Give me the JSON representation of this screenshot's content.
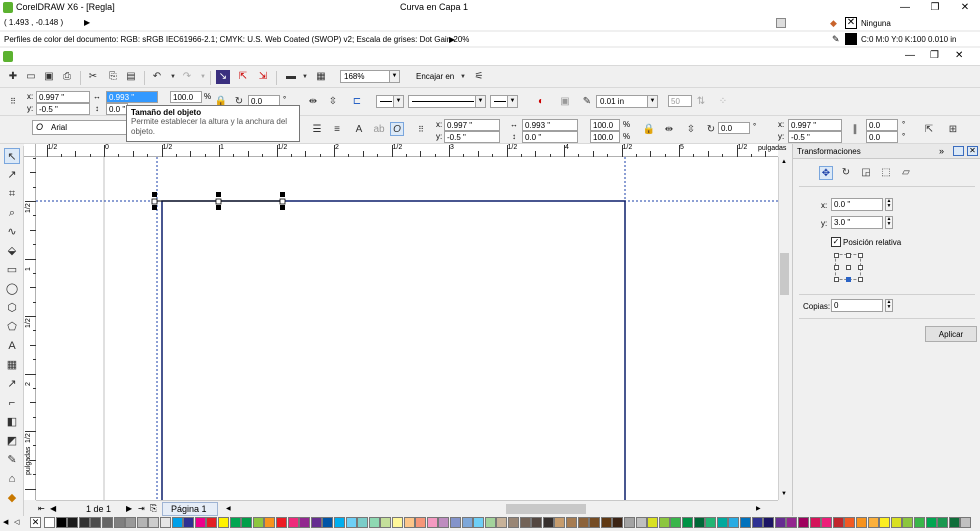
{
  "window": {
    "title": "CorelDRAW X6 - [Regla]",
    "center_status": "Curva en Capa 1",
    "controls": {
      "minimize": "—",
      "restore": "❐",
      "close": "✕"
    }
  },
  "status": {
    "coords": "( 1.493 , -0.148 )",
    "coords_arrow": "▶",
    "profiles": "Perfiles de color del documento: RGB: sRGB IEC61966-2.1; CMYK: U.S. Web Coated (SWOP) v2; Escala de grises: Dot Gain 20%",
    "profiles_arrow": "▶",
    "fill_label": "Ninguna",
    "outline_label": "C:0 M:0 Y:0 K:100  0.010 in"
  },
  "standard_toolbar": {
    "zoom": "168%",
    "snap_label": "Encajar en"
  },
  "property_bar": {
    "x_label": "x:",
    "x_value": "0.997 \"",
    "y_label": "y:",
    "y_value": "-0.5 \"",
    "width_value": "0.993 \"",
    "height_value": "0.0 \"",
    "scale_w": "100.0",
    "percent": "%",
    "rotation": "0.0",
    "outline_width": "0.01 in",
    "smooth_value": "50"
  },
  "tooltip": {
    "title": "Tamaño del objeto",
    "body": "Permite establecer la altura y la anchura del objeto."
  },
  "text_bar": {
    "font": "Arial",
    "x_label": "x:",
    "x_value": "0.997 \"",
    "y_label": "y:",
    "y_value": "-0.5 \"",
    "w_value": "0.993 \"",
    "h_value": "0.0 \"",
    "scale_a": "100.0",
    "scale_b": "100.0",
    "rotation": "0.0",
    "deg": "°",
    "x2_value": "0.997 \"",
    "y2_value": "-0.5 \"",
    "skew_a": "0.0",
    "skew_b": "0.0"
  },
  "rulers": {
    "h_labels": [
      "1/2",
      "0",
      "1/2",
      "1",
      "1/2",
      "2",
      "1/2",
      "3",
      "1/2",
      "4",
      "1/2",
      "5",
      "1/2"
    ],
    "h_unit": "pulgadas",
    "v_labels": [
      "1/2",
      "1",
      "1/2",
      "2",
      "1/2"
    ],
    "v_unit": "pulgadas"
  },
  "page_nav": {
    "page_count": "1 de 1",
    "page_tab": "Página 1"
  },
  "docker": {
    "title": "Transformaciones",
    "x_label": "x:",
    "x_value": "0.0 \"",
    "y_label": "y:",
    "y_value": "3.0 \"",
    "relative_label": "Posición relativa",
    "copies_label": "Copias:",
    "copies_value": "0",
    "apply_label": "Aplicar"
  },
  "palette_colors": [
    "#ffffff",
    "#000000",
    "#1a1a1a",
    "#333333",
    "#4d4d4d",
    "#666666",
    "#808080",
    "#999999",
    "#b3b3b3",
    "#cccccc",
    "#e6e6e6",
    "#00a0e9",
    "#2e3192",
    "#ec008c",
    "#e31e24",
    "#fff200",
    "#00a651",
    "#009e49",
    "#8dc63f",
    "#f7941d",
    "#ed1c24",
    "#ee2a7b",
    "#92278f",
    "#662d91",
    "#0054a6",
    "#00aeef",
    "#6dcff6",
    "#7accc8",
    "#8ed8b2",
    "#c4df9b",
    "#fff799",
    "#fdc689",
    "#f69679",
    "#f49ac1",
    "#bd8cbf",
    "#8393ca",
    "#7da7d9",
    "#6ecff6",
    "#a3d39c",
    "#c7b299",
    "#998675",
    "#736357",
    "#534741",
    "#362f2d",
    "#c69c6d",
    "#a67c52",
    "#8c6239",
    "#754c24",
    "#603913",
    "#3c2415",
    "#a3a3a3",
    "#bfbfbf",
    "#d9e021",
    "#8cc63f",
    "#39b54a",
    "#009245",
    "#006837",
    "#22b573",
    "#00a99d",
    "#29abe2",
    "#0071bc",
    "#2e3192",
    "#1b1464",
    "#662d91",
    "#93278f",
    "#9e005d",
    "#d4145a",
    "#ed1e79",
    "#c1272d",
    "#f15a24",
    "#f7931e",
    "#fbb03b",
    "#fcee21",
    "#d9e021",
    "#8cc63f",
    "#39b54a",
    "#00a651",
    "#1a9850",
    "#0f6e3a",
    "#c0c0c0"
  ]
}
